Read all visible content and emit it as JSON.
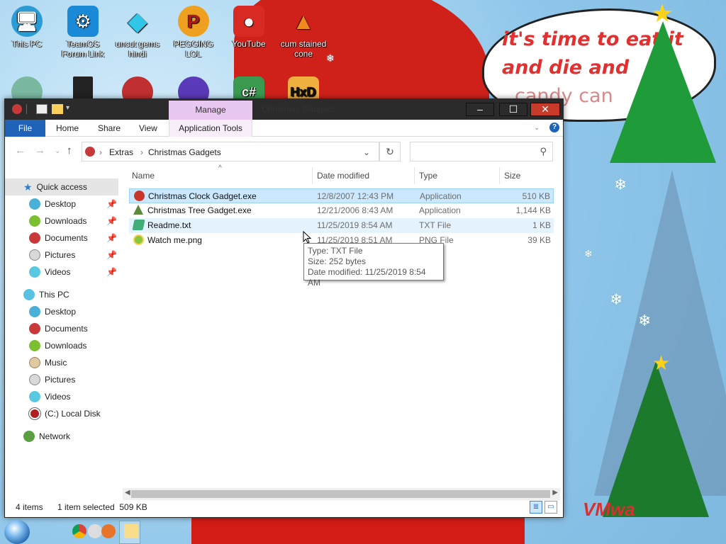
{
  "desktop": {
    "icons": [
      {
        "label": "This PC",
        "icon": "computer-icon",
        "color": "#2b9bd6"
      },
      {
        "label": "TeamOS Forum Link",
        "icon": "gear-icon",
        "color": "#1a8ad8"
      },
      {
        "label": "uncut gems hindi",
        "icon": "diamond-icon",
        "color": "#31c6e8"
      },
      {
        "label": "PEGGING LOL",
        "icon": "p-logo-icon",
        "color": "#f0a020"
      },
      {
        "label": "YouTube",
        "icon": "angry-bird-icon",
        "color": "#d82a22"
      },
      {
        "label": "cum stained cone",
        "icon": "traffic-cone-icon",
        "color": "#f08a1c"
      }
    ],
    "wallpaper_text": [
      "it's time to eat it",
      "and die and",
      "candy can"
    ],
    "watermark": "VMwa"
  },
  "window": {
    "title": "Christmas Gadgets",
    "manage_tab": "Manage",
    "controls": {
      "minimize": "–",
      "maximize": "☐",
      "close": "✕"
    },
    "ribbon_tabs": [
      "File",
      "Home",
      "Share",
      "View",
      "Application Tools"
    ],
    "help": "?",
    "address": {
      "crumbs": [
        "Extras",
        "Christmas Gadgets"
      ],
      "separator": "›"
    },
    "search_placeholder": "",
    "nav": {
      "quick_access": "Quick access",
      "quick_items": [
        "Desktop",
        "Downloads",
        "Documents",
        "Pictures",
        "Videos"
      ],
      "this_pc": "This PC",
      "pc_items": [
        "Desktop",
        "Documents",
        "Downloads",
        "Music",
        "Pictures",
        "Videos",
        "(C:) Local Disk"
      ],
      "network": "Network"
    },
    "columns": {
      "name": "Name",
      "date": "Date modified",
      "type": "Type",
      "size": "Size"
    },
    "files": [
      {
        "name": "Christmas Clock Gadget.exe",
        "date": "12/8/2007 12:43 PM",
        "type": "Application",
        "size": "510 KB",
        "icon": "clock-ornament-icon",
        "color": "#c8372a",
        "state": "selected"
      },
      {
        "name": "Christmas Tree Gadget.exe",
        "date": "12/21/2006 8:43 AM",
        "type": "Application",
        "size": "1,144 KB",
        "icon": "tree-icon",
        "color": "#5a8a3a",
        "state": "normal"
      },
      {
        "name": "Readme.txt",
        "date": "11/25/2019 8:54 AM",
        "type": "TXT File",
        "size": "1 KB",
        "icon": "text-file-icon",
        "color": "#3fae7a",
        "state": "hover"
      },
      {
        "name": "Watch me.png",
        "date": "11/25/2019 8:51 AM",
        "type": "PNG File",
        "size": "39 KB",
        "icon": "image-file-icon",
        "color": "#8cc63e",
        "state": "normal"
      }
    ],
    "tooltip": {
      "type": "Type: TXT File",
      "size": "Size: 252 bytes",
      "date": "Date modified: 11/25/2019 8:54 AM"
    },
    "status": {
      "count": "4 items",
      "selection": "1 item selected  509 KB"
    }
  },
  "colors": {
    "accent": "#1f63b8",
    "selection": "#cce8ff",
    "manage": "#e8c7f0"
  }
}
